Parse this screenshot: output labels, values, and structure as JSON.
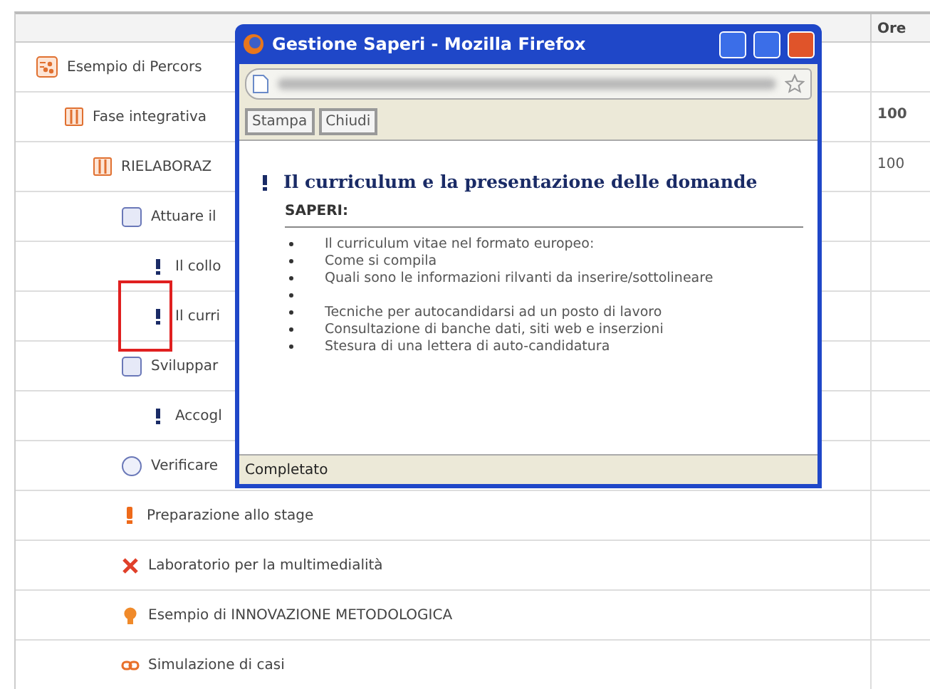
{
  "table": {
    "columns": [
      {
        "label": "Ore"
      }
    ],
    "tree": [
      {
        "kind": "module",
        "label": "Esempio di Percors",
        "children": [
          {
            "kind": "phase",
            "label": "Fase integrativa",
            "hours": "100",
            "bold_hours": true,
            "children": [
              {
                "kind": "phase",
                "label": "RIELABORAZ",
                "hours": "100",
                "bold_hours": false,
                "children": [
                  {
                    "kind": "square",
                    "label": "Attuare il",
                    "children": [
                      {
                        "kind": "exclamation",
                        "label": "Il collo"
                      },
                      {
                        "kind": "exclamation",
                        "label": "Il curri",
                        "marked": true
                      }
                    ]
                  },
                  {
                    "kind": "square",
                    "label": "Sviluppar",
                    "children": [
                      {
                        "kind": "exclamation",
                        "label": "Accogl"
                      }
                    ]
                  },
                  {
                    "kind": "circle",
                    "label": "Verificare"
                  },
                  {
                    "kind": "warning",
                    "label": "Preparazione allo stage"
                  },
                  {
                    "kind": "tools",
                    "label": "Laboratorio per la multimedialità"
                  },
                  {
                    "kind": "bulb",
                    "label": "Esempio di INNOVAZIONE METODOLOGICA"
                  },
                  {
                    "kind": "link",
                    "label": "Simulazione di casi"
                  }
                ]
              }
            ]
          }
        ]
      }
    ]
  },
  "popup": {
    "title": "Gestione Saperi - Mozilla Firefox",
    "buttons": [
      "Stampa",
      "Chiudi"
    ],
    "heading": "Il curriculum e la presentazione delle domande",
    "subheading": "SAPERI:",
    "items": [
      {
        "kind": "text",
        "text": "Il curriculum vitae nel formato europeo:"
      },
      {
        "kind": "text",
        "text": "Come si compila"
      },
      {
        "kind": "text",
        "text": "Quali sono le informazioni rilvanti da inserire/sottolineare"
      },
      {
        "kind": "empty"
      },
      {
        "kind": "text",
        "text": "Tecniche per autocandidarsi ad un posto di lavoro"
      },
      {
        "kind": "text",
        "text": "Consultazione di banche dati, siti web e inserzioni"
      },
      {
        "kind": "text",
        "text": "Stesura di una lettera di auto-candidatura"
      }
    ],
    "status": "Completato"
  }
}
